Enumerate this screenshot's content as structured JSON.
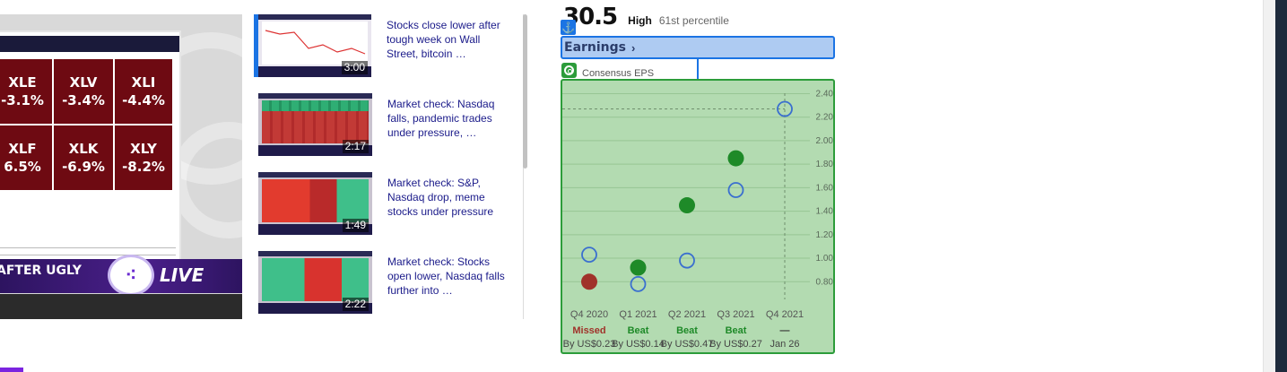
{
  "player": {
    "heatmap": [
      {
        "ticker": "XLE",
        "change": "-3.1%"
      },
      {
        "ticker": "XLV",
        "change": "-3.4%"
      },
      {
        "ticker": "XLI",
        "change": "-4.4%"
      },
      {
        "ticker": "XLF",
        "change": "6.5%"
      },
      {
        "ticker": "XLK",
        "change": "-6.9%"
      },
      {
        "ticker": "XLY",
        "change": "-8.2%"
      }
    ],
    "headline": "AFTER UGLY",
    "live_label": "LIVE",
    "logo_icon": "yahoo-finance-logo",
    "colors": {
      "cell": "#6e0a12",
      "banner": "#4a1f8a"
    }
  },
  "playlist": {
    "items": [
      {
        "title": "Stocks close lower after tough week on Wall Street, bitcoin …",
        "duration": "3:00",
        "active": true
      },
      {
        "title": "Market check: Nasdaq falls, pandemic trades under pressure, …",
        "duration": "2:17",
        "active": false
      },
      {
        "title": "Market check: S&P, Nasdaq drop, meme stocks under pressure",
        "duration": "1:49",
        "active": false
      },
      {
        "title": "Market check: Stocks open lower, Nasdaq falls further into …",
        "duration": "2:22",
        "active": false
      }
    ]
  },
  "earnings_panel": {
    "score": "30.5",
    "level": "High",
    "percentile": "61st percentile",
    "tab_label": "Earnings",
    "chevron_icon": "chevron-right-icon",
    "anchor_icon": "anchor-icon",
    "target_icon": "target-icon",
    "series_label": "Consensus EPS",
    "colors": {
      "beat": "#1e8a28",
      "missed": "#a0322a",
      "estimate": "#3a6fcf",
      "panel_bg": "#b3dbb1"
    }
  },
  "chart_data": {
    "type": "scatter",
    "y_ticks": [
      "0.80",
      "1.00",
      "1.20",
      "1.40",
      "1.60",
      "1.80",
      "2.00",
      "2.20",
      "2.40"
    ],
    "ylim": [
      0.68,
      2.48
    ],
    "categories": [
      "Q4 2020",
      "Q1 2021",
      "Q2 2021",
      "Q3 2021",
      "Q4 2021"
    ],
    "results": [
      "Missed",
      "Beat",
      "Beat",
      "Beat",
      "—"
    ],
    "sublabels": [
      "By US$0.23",
      "By US$0.14",
      "By US$0.47",
      "By US$0.27",
      "Jan 26"
    ],
    "series": [
      {
        "name": "Consensus EPS",
        "values": [
          1.03,
          0.78,
          0.98,
          1.58,
          2.27
        ]
      },
      {
        "name": "Actual EPS",
        "values": [
          0.8,
          0.92,
          1.45,
          1.85,
          null
        ]
      }
    ]
  }
}
